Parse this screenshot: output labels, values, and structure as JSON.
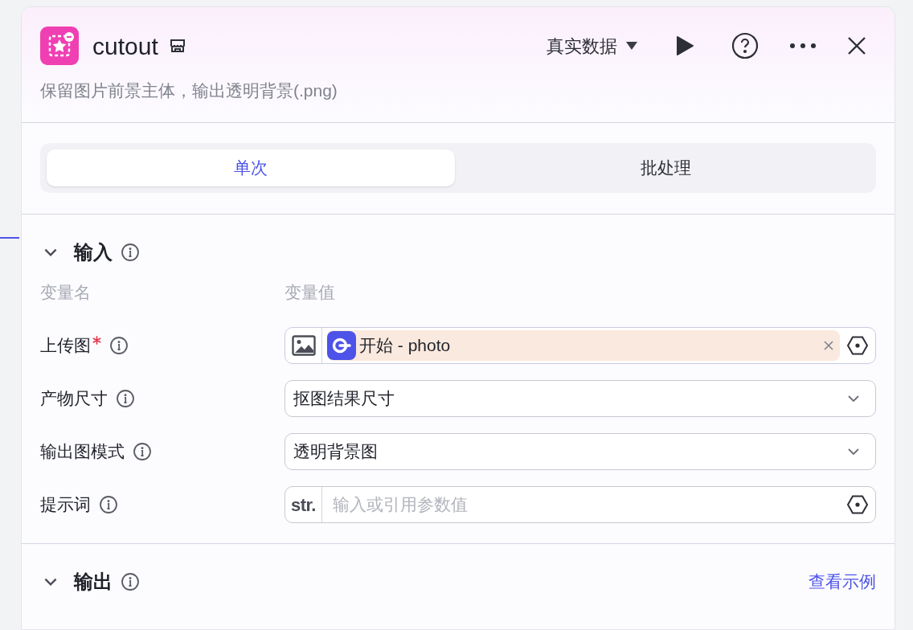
{
  "header": {
    "title": "cutout",
    "description": "保留图片前景主体，输出透明背景(.png)",
    "mode": "真实数据"
  },
  "tabs": [
    {
      "label": "单次",
      "selected": true
    },
    {
      "label": "批处理",
      "selected": false
    }
  ],
  "input": {
    "title": "输入",
    "expanded": true,
    "columns": [
      "变量名",
      "变量值"
    ],
    "params": [
      {
        "label": "上传图",
        "required": true,
        "kind": "reference",
        "value": "开始 - photo"
      },
      {
        "label": "产物尺寸",
        "required": false,
        "kind": "select",
        "value": "抠图结果尺寸"
      },
      {
        "label": "输出图模式",
        "required": false,
        "kind": "select",
        "value": "透明背景图"
      },
      {
        "label": "提示词",
        "required": false,
        "kind": "text",
        "prefix": "str.",
        "placeholder": "输入或引用参数值"
      }
    ]
  },
  "output": {
    "title": "输出",
    "expanded": true,
    "link": "查看示例"
  }
}
